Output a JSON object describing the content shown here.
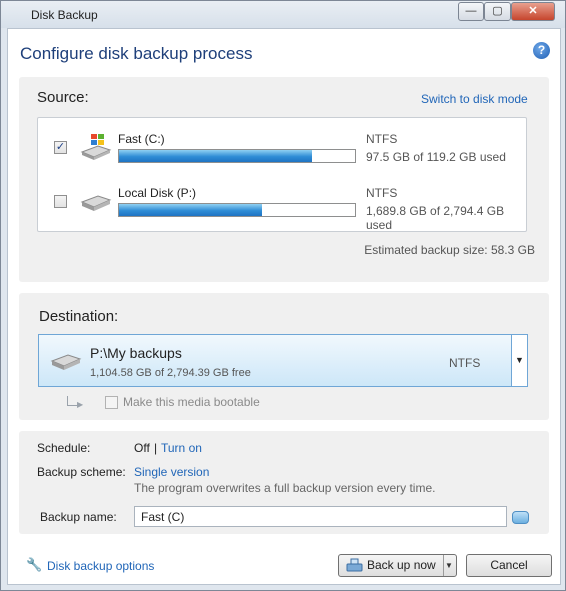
{
  "window": {
    "title": "Disk Backup",
    "minimize": "—",
    "maximize": "▢",
    "close": "✕"
  },
  "header": {
    "title": "Configure disk backup process",
    "help": "?"
  },
  "source": {
    "label": "Source:",
    "switch_link": "Switch to disk mode",
    "disks": [
      {
        "name": "Fast (C:)",
        "fs": "NTFS",
        "usage": "97.5 GB of 119.2 GB used",
        "used_fraction": 0.818,
        "checked": true
      },
      {
        "name": "Local Disk (P:)",
        "fs": "NTFS",
        "usage": "1,689.8 GB of 2,794.4 GB used",
        "used_fraction": 0.605,
        "checked": false
      }
    ],
    "estimate": "Estimated backup size: 58.3 GB"
  },
  "destination": {
    "label": "Destination:",
    "path": "P:\\My backups",
    "free": "1,104.58 GB of 2,794.39 GB free",
    "fs": "NTFS",
    "bootable_label": "Make this media bootable"
  },
  "settings": {
    "schedule_label": "Schedule:",
    "schedule_value": "Off",
    "schedule_sep": "|",
    "schedule_link": "Turn on",
    "scheme_label": "Backup scheme:",
    "scheme_link": "Single version",
    "scheme_desc": "The program overwrites a full backup version every time.",
    "name_label": "Backup name:",
    "name_value": "Fast (C)"
  },
  "footer": {
    "options_link": "Disk backup options",
    "backup_button": "Back up now",
    "cancel_button": "Cancel"
  },
  "colors": {
    "accent": "#1e3f7a",
    "link": "#2166b8",
    "bar": "#2f8dd6"
  }
}
